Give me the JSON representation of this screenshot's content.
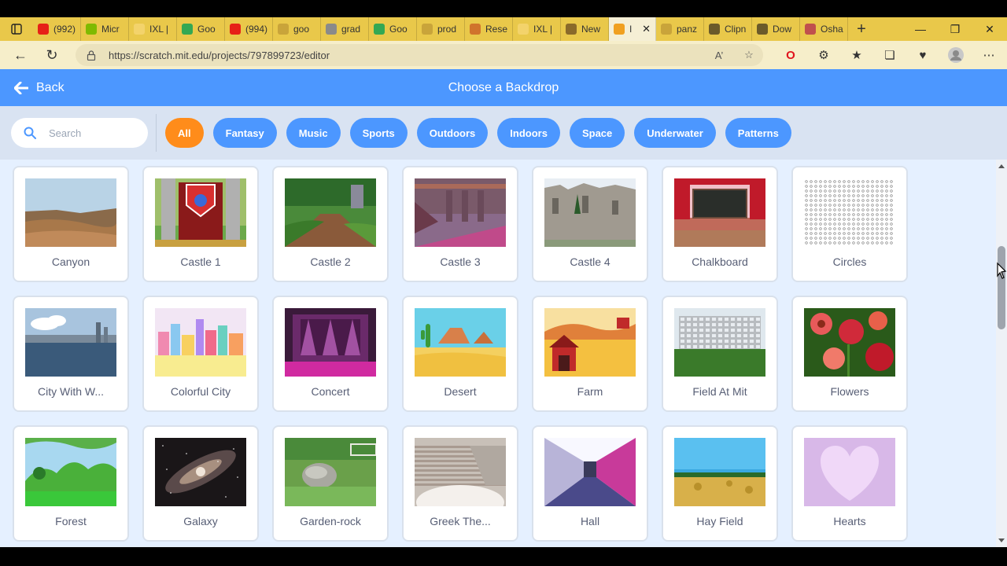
{
  "browser": {
    "tabs": [
      {
        "label": "(992)",
        "color": "#e62117"
      },
      {
        "label": "Micr",
        "color": "#7fba00"
      },
      {
        "label": "IXL | ",
        "color": "#f3d36b"
      },
      {
        "label": "Goo",
        "color": "#34a853"
      },
      {
        "label": "(994)",
        "color": "#e62117"
      },
      {
        "label": "goo",
        "color": "#c9a43a"
      },
      {
        "label": "grad",
        "color": "#8a8a8a"
      },
      {
        "label": "Goo",
        "color": "#34a853"
      },
      {
        "label": "prod",
        "color": "#c9a43a"
      },
      {
        "label": "Rese",
        "color": "#d0732c"
      },
      {
        "label": "IXL | ",
        "color": "#f3d36b"
      },
      {
        "label": "New",
        "color": "#8a6a2a"
      },
      {
        "label": "І",
        "color": "#f0a020"
      },
      {
        "label": "panz",
        "color": "#c9a43a"
      },
      {
        "label": "Clipn",
        "color": "#6b5a2a"
      },
      {
        "label": "Dow",
        "color": "#6b5a2a"
      },
      {
        "label": "Osha",
        "color": "#c0504d"
      }
    ],
    "url": "https://scratch.mit.edu/projects/797899723/editor"
  },
  "header": {
    "back_label": "Back",
    "title": "Choose a Backdrop"
  },
  "search": {
    "placeholder": "Search"
  },
  "filters": [
    "All",
    "Fantasy",
    "Music",
    "Sports",
    "Outdoors",
    "Indoors",
    "Space",
    "Underwater",
    "Patterns"
  ],
  "backdrops": [
    {
      "name": "Canyon",
      "art": "canyon"
    },
    {
      "name": "Castle 1",
      "art": "castle1"
    },
    {
      "name": "Castle 2",
      "art": "castle2"
    },
    {
      "name": "Castle 3",
      "art": "castle3"
    },
    {
      "name": "Castle 4",
      "art": "castle4"
    },
    {
      "name": "Chalkboard",
      "art": "chalkboard"
    },
    {
      "name": "Circles",
      "art": "circles"
    },
    {
      "name": "City With W...",
      "art": "city"
    },
    {
      "name": "Colorful City",
      "art": "colorful"
    },
    {
      "name": "Concert",
      "art": "concert"
    },
    {
      "name": "Desert",
      "art": "desert"
    },
    {
      "name": "Farm",
      "art": "farm"
    },
    {
      "name": "Field At Mit",
      "art": "field"
    },
    {
      "name": "Flowers",
      "art": "flowers"
    },
    {
      "name": "Forest",
      "art": "forest"
    },
    {
      "name": "Galaxy",
      "art": "galaxy"
    },
    {
      "name": "Garden-rock",
      "art": "garden"
    },
    {
      "name": "Greek The...",
      "art": "greek"
    },
    {
      "name": "Hall",
      "art": "hall"
    },
    {
      "name": "Hay Field",
      "art": "hay"
    },
    {
      "name": "Hearts",
      "art": "hearts"
    }
  ],
  "colors": {
    "accent": "#4c97ff",
    "active_filter": "#ff8c1a",
    "tabstrip": "#e9c84a"
  }
}
